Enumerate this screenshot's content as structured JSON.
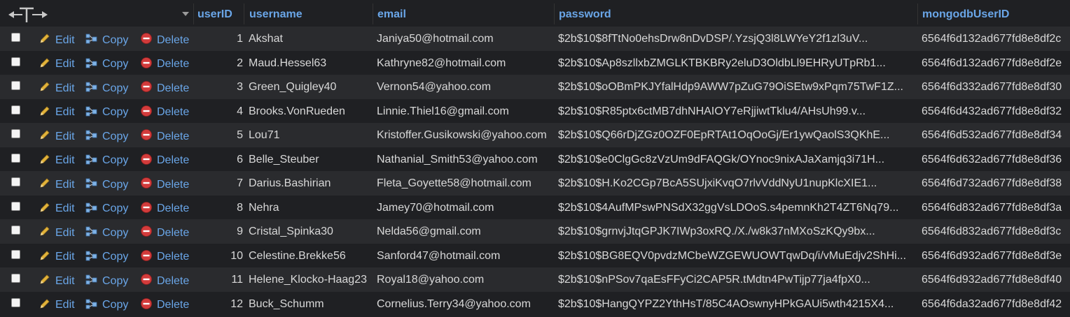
{
  "header": {
    "columns": [
      "userID",
      "username",
      "email",
      "password",
      "mongodbUserID"
    ]
  },
  "actions": {
    "edit": "Edit",
    "copy": "Copy",
    "delete": "Delete"
  },
  "colors": {
    "link": "#6aa6e8",
    "row_even": "#2a2b2e",
    "row_odd": "#1f2023",
    "delete_icon": "#d23b3b",
    "edit_icon": "#e2b33a"
  },
  "rows": [
    {
      "userID": "1",
      "username": "Akshat",
      "email": "Janiya50@hotmail.com",
      "password": "$2b$10$8fTtNo0ehsDrw8nDvDSP/.YzsjQ3l8LWYeY2f1zl3uV...",
      "mongodbUserID": "6564f6d132ad677fd8e8df2c"
    },
    {
      "userID": "2",
      "username": "Maud.Hessel63",
      "email": "Kathryne82@hotmail.com",
      "password": "$2b$10$Ap8szllxbZMGLKTBKBRy2eluD3OldbLl9EHRyUTpRb1...",
      "mongodbUserID": "6564f6d132ad677fd8e8df2e"
    },
    {
      "userID": "3",
      "username": "Green_Quigley40",
      "email": "Vernon54@yahoo.com",
      "password": "$2b$10$oOBmPKJYfalHdp9AWW7pZuG79OiSEtw9xPqm75TwF1Z...",
      "mongodbUserID": "6564f6d332ad677fd8e8df30"
    },
    {
      "userID": "4",
      "username": "Brooks.VonRueden",
      "email": "Linnie.Thiel16@gmail.com",
      "password": "$2b$10$R85ptx6ctMB7dhNHAIOY7eRjjiwtTklu4/AHsUh99.v...",
      "mongodbUserID": "6564f6d432ad677fd8e8df32"
    },
    {
      "userID": "5",
      "username": "Lou71",
      "email": "Kristoffer.Gusikowski@yahoo.com",
      "password": "$2b$10$Q66rDjZGz0OZF0EpRTAt1OqOoGj/Er1ywQaolS3QKhE...",
      "mongodbUserID": "6564f6d532ad677fd8e8df34"
    },
    {
      "userID": "6",
      "username": "Belle_Steuber",
      "email": "Nathanial_Smith53@yahoo.com",
      "password": "$2b$10$e0ClgGc8zVzUm9dFAQGk/OYnoc9nixAJaXamjq3i71H...",
      "mongodbUserID": "6564f6d632ad677fd8e8df36"
    },
    {
      "userID": "7",
      "username": "Darius.Bashirian",
      "email": "Fleta_Goyette58@hotmail.com",
      "password": "$2b$10$H.Ko2CGp7BcA5SUjxiKvqO7rlvVddNyU1nupKlcXIE1...",
      "mongodbUserID": "6564f6d732ad677fd8e8df38"
    },
    {
      "userID": "8",
      "username": "Nehra",
      "email": "Jamey70@hotmail.com",
      "password": "$2b$10$4AufMPswPNSdX32ggVsLDOoS.s4pemnKh2T4ZT6Nq79...",
      "mongodbUserID": "6564f6d832ad677fd8e8df3a"
    },
    {
      "userID": "9",
      "username": "Cristal_Spinka30",
      "email": "Nelda56@gmail.com",
      "password": "$2b$10$grnvjJtqGPJK7IWp3oxRQ./X./w8k37nMXoSzKQy9bx...",
      "mongodbUserID": "6564f6d832ad677fd8e8df3c"
    },
    {
      "userID": "10",
      "username": "Celestine.Brekke56",
      "email": "Sanford47@hotmail.com",
      "password": "$2b$10$BG8EQV0pvdzMCbeWZGEWUOWTqwDq/i/vMuEdjv2ShHi...",
      "mongodbUserID": "6564f6d932ad677fd8e8df3e"
    },
    {
      "userID": "11",
      "username": "Helene_Klocko-Haag23",
      "email": "Royal18@yahoo.com",
      "password": "$2b$10$nPSov7qaEsFFyCi2CAP5R.tMdtn4PwTijp77ja4fpX0...",
      "mongodbUserID": "6564f6d932ad677fd8e8df40"
    },
    {
      "userID": "12",
      "username": "Buck_Schumm",
      "email": "Cornelius.Terry34@yahoo.com",
      "password": "$2b$10$HangQYPZ2YthHsT/85C4AOswnyHPkGAUi5wth4215X4...",
      "mongodbUserID": "6564f6da32ad677fd8e8df42"
    }
  ]
}
